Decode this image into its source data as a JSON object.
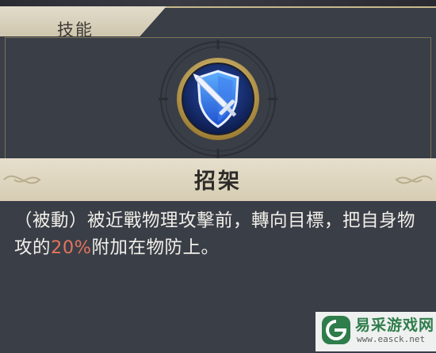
{
  "tab": {
    "label": "技能"
  },
  "skill": {
    "icon": "shield-sword-icon",
    "name": "招架",
    "description_pre": "（被動）被近戰物理攻擊前，轉向目標，把自身物攻的",
    "description_value": "20%",
    "description_post": "附加在物防上。"
  },
  "watermark": {
    "title": "易采游戏网",
    "url": "www.easck.net",
    "logo": "easck-logo"
  },
  "colors": {
    "accent_gold": "#c8b98d",
    "highlight": "#e3745c",
    "shield_blue": "#2d5fd8",
    "watermark_green": "#2e7d4b"
  }
}
